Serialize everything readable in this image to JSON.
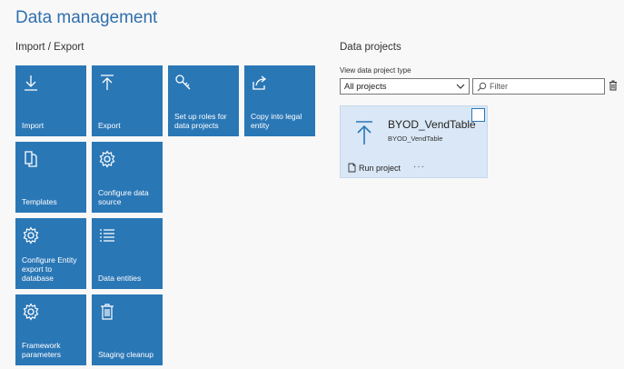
{
  "page": {
    "title": "Data management"
  },
  "import_export": {
    "heading": "Import / Export",
    "tiles": [
      {
        "label": "Import",
        "icon": "download-icon"
      },
      {
        "label": "Export",
        "icon": "upload-icon"
      },
      {
        "label": "Set up roles for data projects",
        "icon": "key-icon"
      },
      {
        "label": "Copy into legal entity",
        "icon": "share-icon"
      },
      {
        "label": "Templates",
        "icon": "copy-icon"
      },
      {
        "label": "Configure data source",
        "icon": "gear-icon"
      },
      {
        "label": "Configure Entity export to database",
        "icon": "gear-icon"
      },
      {
        "label": "Data entities",
        "icon": "list-icon"
      },
      {
        "label": "Framework parameters",
        "icon": "gear-icon"
      },
      {
        "label": "Staging cleanup",
        "icon": "trash-icon"
      }
    ]
  },
  "data_projects": {
    "heading": "Data projects",
    "type_label": "View data project type",
    "type_value": "All projects",
    "filter_placeholder": "Filter",
    "project": {
      "name": "BYOD_VendTable",
      "subtitle": "BYOD_VendTable",
      "run_label": "Run project",
      "more_label": "···"
    }
  },
  "colors": {
    "tile": "#2a77b6",
    "title": "#2f6fae",
    "card": "#d9e7f6"
  }
}
